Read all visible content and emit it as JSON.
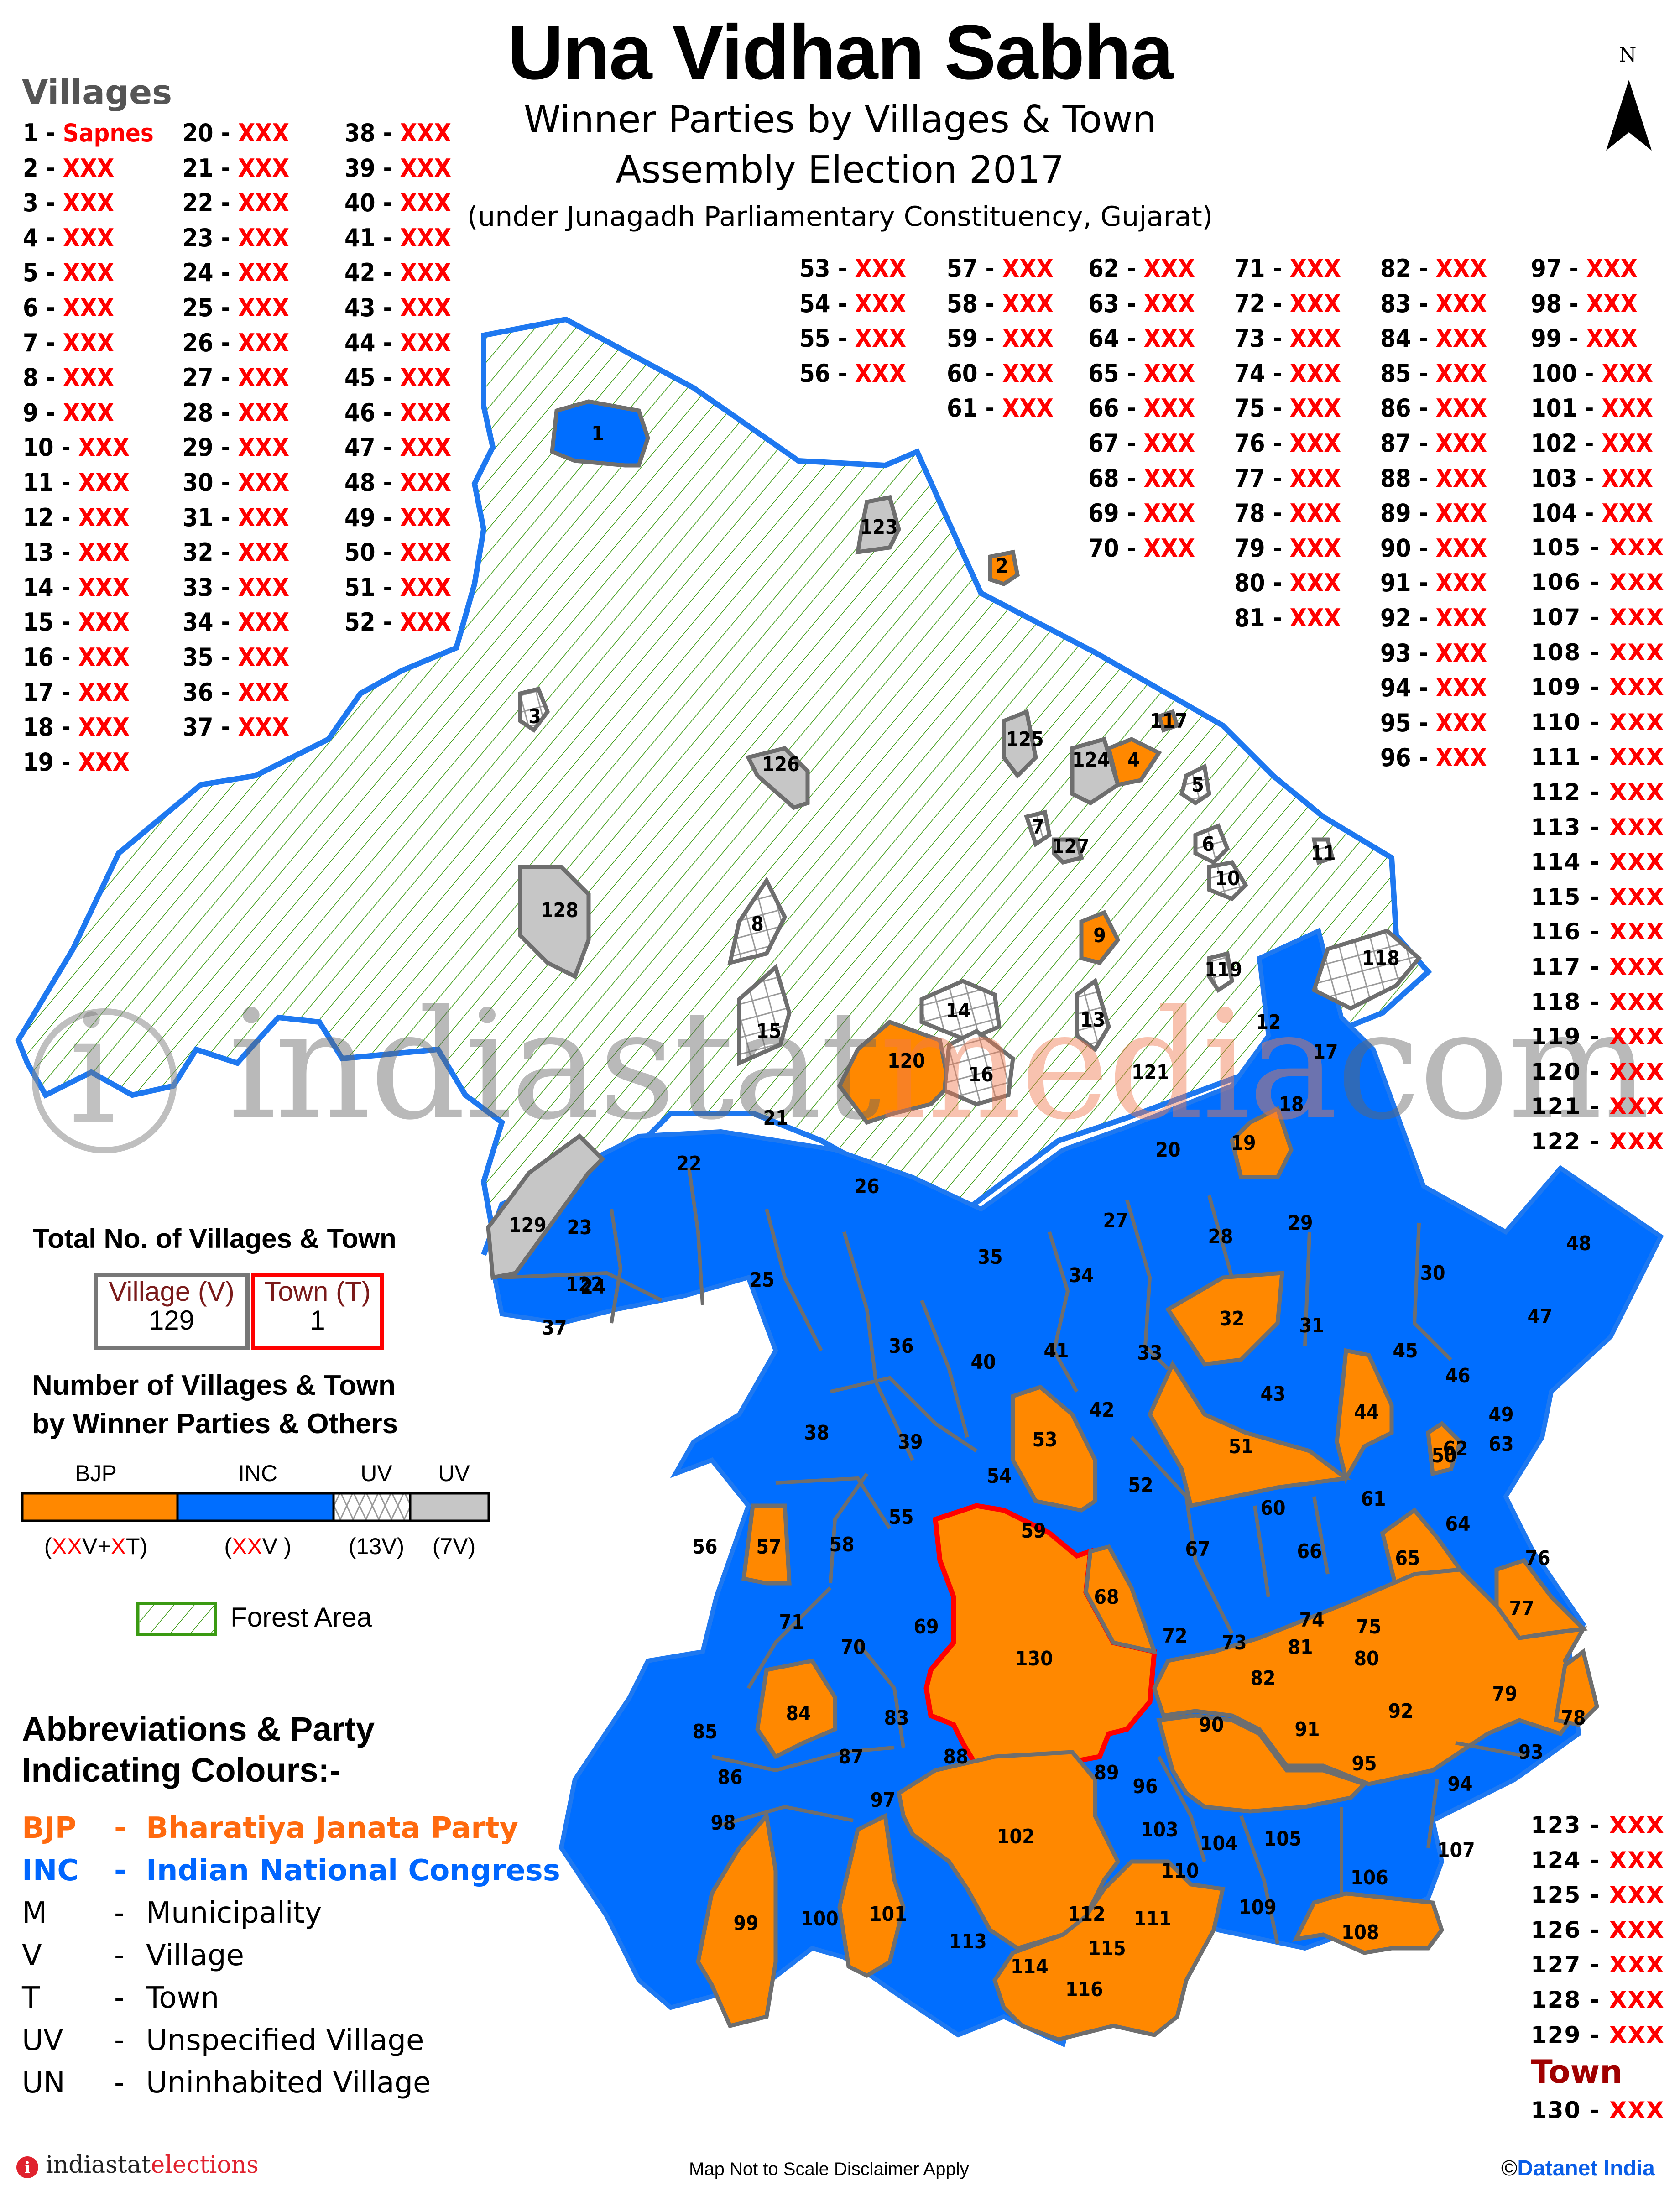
{
  "header": {
    "title": "Una Vidhan Sabha",
    "subtitle1": "Winner Parties by Villages & Town",
    "subtitle2": "Assembly Election 2017",
    "subtitle3": "(under Junagadh Parliamentary Constituency, Gujarat)"
  },
  "north_arrow": {
    "label": "N"
  },
  "villages_heading": "Villages",
  "village_names": {
    "1": "Sapnes",
    "placeholder": "XXX"
  },
  "town_heading": "Town",
  "totals": {
    "title": "Total No. of Villages & Town",
    "village_label": "Village (V)",
    "village_count": "129",
    "town_label": "Town (T)",
    "town_count": "1"
  },
  "party_breakdown": {
    "title_line1": "Number of Villages & Town",
    "title_line2": "by Winner Parties & Others",
    "segments": [
      {
        "label": "BJP",
        "count_prefix": "(",
        "count_red1": "XX",
        "count_mid": "V+",
        "count_red2": "X",
        "count_suffix": "T)",
        "color": "#FF8800"
      },
      {
        "label": "INC",
        "count_prefix": "(",
        "count_red1": "XX",
        "count_mid": "V )",
        "count_red2": "",
        "count_suffix": "",
        "color": "#006EFF"
      },
      {
        "label": "UV",
        "count_prefix": "(13V)",
        "count_red1": "",
        "count_mid": "",
        "count_red2": "",
        "count_suffix": "",
        "color": "#FFFFFF"
      },
      {
        "label": "UV",
        "count_prefix": "(7V)",
        "count_red1": "",
        "count_mid": "",
        "count_red2": "",
        "count_suffix": "",
        "color": "#C6C6C6"
      }
    ],
    "forest_label": "Forest Area"
  },
  "abbreviations": {
    "title_line1": "Abbreviations & Party",
    "title_line2": "Indicating Colours:-",
    "items": [
      {
        "abbr": "BJP",
        "sep": "-",
        "full": "Bharatiya Janata Party",
        "color": "#FF6A0E"
      },
      {
        "abbr": "INC",
        "sep": "-",
        "full": "Indian National Congress",
        "color": "#0066FF"
      },
      {
        "abbr": "M",
        "sep": "-",
        "full": "Municipality",
        "color": "#000000"
      },
      {
        "abbr": "V",
        "sep": "-",
        "full": "Village",
        "color": "#000000"
      },
      {
        "abbr": "T",
        "sep": "-",
        "full": "Town",
        "color": "#000000"
      },
      {
        "abbr": "UV",
        "sep": "-",
        "full": "Unspecified Village",
        "color": "#000000"
      },
      {
        "abbr": "UN",
        "sep": "-",
        "full": "Uninhabited Village",
        "color": "#000000"
      }
    ]
  },
  "footer": {
    "brand_part1": "indiastat",
    "brand_part2": "elections",
    "note": "Map Not to Scale   Disclaimer Apply",
    "copyright": "©",
    "copyright_owner": "Datanet India"
  },
  "watermark": {
    "part1": "indiastat",
    "part2": "media",
    "part3": "com"
  },
  "colors": {
    "bjp": "#FF8800",
    "inc": "#006EFF",
    "uv_grey": "#C6C6C6",
    "forest": "#3A9A12",
    "boundary": "#1E78F0",
    "town_border": "#FF0000"
  },
  "map_regions": [
    {
      "id": "1",
      "party": "INC"
    },
    {
      "id": "2",
      "party": "BJP"
    },
    {
      "id": "3",
      "party": "UV-hatch"
    },
    {
      "id": "4",
      "party": "BJP"
    },
    {
      "id": "5",
      "party": "UV-hatch"
    },
    {
      "id": "6",
      "party": "UV-hatch"
    },
    {
      "id": "7",
      "party": "UV-hatch"
    },
    {
      "id": "8",
      "party": "UV-hatch"
    },
    {
      "id": "9",
      "party": "BJP"
    },
    {
      "id": "10",
      "party": "UV-hatch"
    },
    {
      "id": "11",
      "party": "UV-hatch"
    },
    {
      "id": "12",
      "party": "INC"
    },
    {
      "id": "13",
      "party": "UV-hatch"
    },
    {
      "id": "14",
      "party": "UV-hatch"
    },
    {
      "id": "15",
      "party": "UV-hatch"
    },
    {
      "id": "16",
      "party": "UV-hatch"
    },
    {
      "id": "17",
      "party": "INC"
    },
    {
      "id": "18",
      "party": "INC"
    },
    {
      "id": "19",
      "party": "BJP"
    },
    {
      "id": "20",
      "party": "INC"
    },
    {
      "id": "117",
      "party": "BJP"
    },
    {
      "id": "118",
      "party": "UV-hatch"
    },
    {
      "id": "119",
      "party": "UV-hatch"
    },
    {
      "id": "120",
      "party": "BJP"
    },
    {
      "id": "121",
      "party": "INC"
    },
    {
      "id": "123",
      "party": "UV-grey"
    },
    {
      "id": "124",
      "party": "UV-grey"
    },
    {
      "id": "125",
      "party": "UV-grey"
    },
    {
      "id": "126",
      "party": "UV-grey"
    },
    {
      "id": "127",
      "party": "UV-grey"
    },
    {
      "id": "128",
      "party": "UV-grey"
    },
    {
      "id": "129",
      "party": "UV-grey"
    },
    {
      "id": "130",
      "party": "BJP-Town"
    }
  ]
}
